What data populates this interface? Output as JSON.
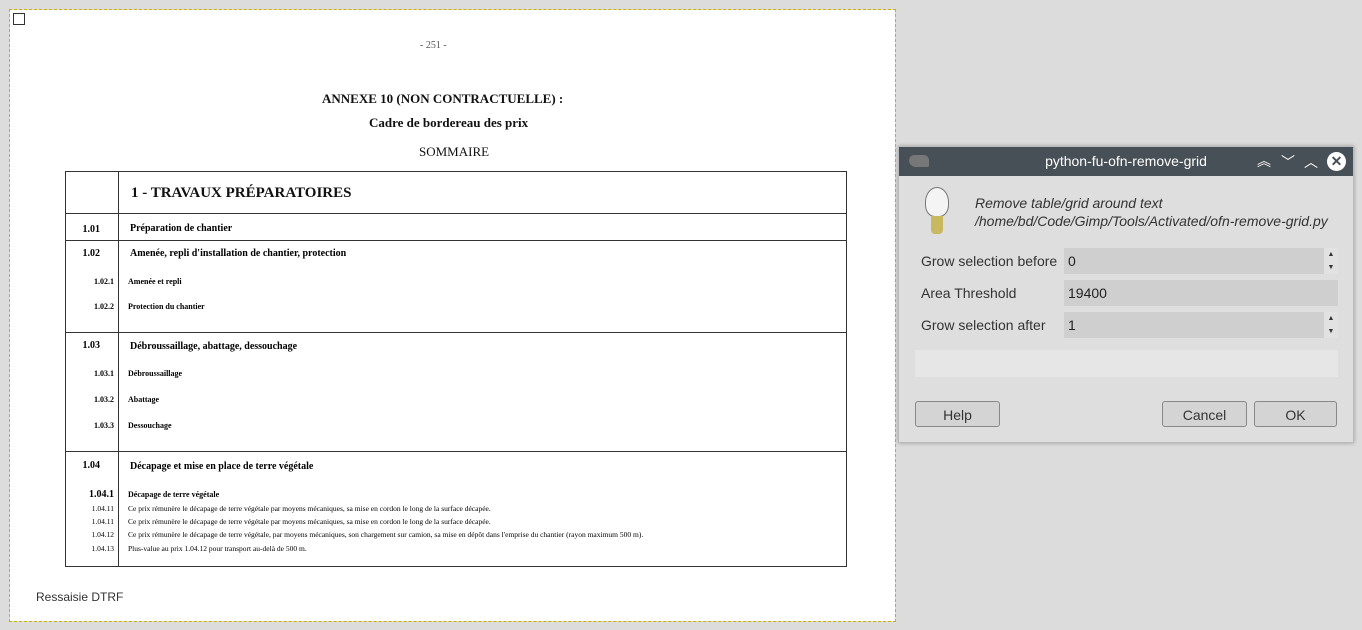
{
  "document": {
    "page_number": "- 251 -",
    "title": "ANNEXE 10 (NON CONTRACTUELLE) :",
    "subtitle": "Cadre de bordereau des prix",
    "summary": "SOMMAIRE",
    "section_header": "1 - TRAVAUX PRÉPARATOIRES",
    "rows": [
      {
        "num": "1.01",
        "text": "Préparation de chantier"
      },
      {
        "num": "1.02",
        "text": "Amenée, repli d'installation de chantier, protection"
      },
      {
        "num": "1.02.1",
        "text": "Amenée et repli"
      },
      {
        "num": "1.02.2",
        "text": "Protection du chantier"
      },
      {
        "num": "1.03",
        "text": "Débroussaillage, abattage, dessouchage"
      },
      {
        "num": "1.03.1",
        "text": "Débroussaillage"
      },
      {
        "num": "1.03.2",
        "text": "Abattage"
      },
      {
        "num": "1.03.3",
        "text": "Dessouchage"
      },
      {
        "num": "1.04",
        "text": "Décapage et mise en place de terre végétale"
      },
      {
        "num": "1.04.1",
        "text": "Décapage de terre végétale"
      },
      {
        "num": "1.04.11",
        "text": "Ce prix rémunère le décapage de terre végétale par moyens mécaniques, sa mise en cordon le long de la surface décapée."
      },
      {
        "num": "1.04.11",
        "text": "Ce prix rémunère le décapage de terre végétale par moyens mécaniques, sa mise en cordon le long de la surface décapée."
      },
      {
        "num": "1.04.12",
        "text": "Ce prix rémunère le décapage de terre végétale, par moyens mécaniques, son chargement sur camion, sa mise en dépôt dans l'emprise du chantier (rayon maximum 500 m)."
      },
      {
        "num": "1.04.13",
        "text": "Plus-value au prix 1.04.12 pour transport au-delà de 500 m."
      }
    ],
    "footer": "Ressaisie DTRF"
  },
  "dialog": {
    "title": "python-fu-ofn-remove-grid",
    "description": "Remove table/grid around text",
    "path": "/home/bd/Code/Gimp/Tools/Activated/ofn-remove-grid.py",
    "fields": [
      {
        "label": "Grow selection before",
        "value": "0"
      },
      {
        "label": "Area Threshold",
        "value": "19400"
      },
      {
        "label": "Grow selection after",
        "value": "1"
      }
    ],
    "help": "Help",
    "cancel": "Cancel",
    "ok": "OK"
  }
}
